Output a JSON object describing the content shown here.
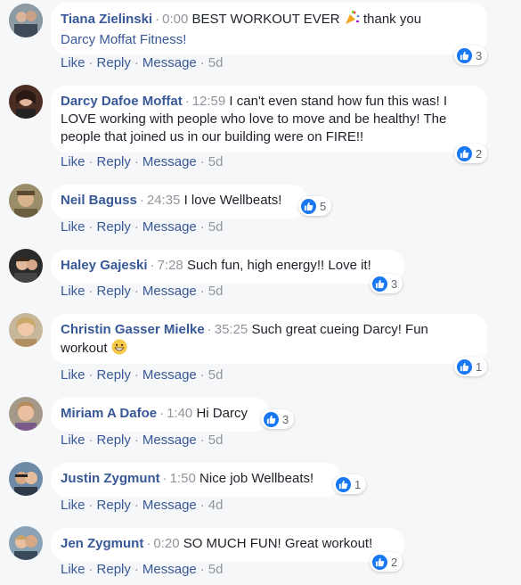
{
  "comments": [
    {
      "author": "Tiana Zielinski",
      "ts": "0:00",
      "text": "BEST WORKOUT EVER",
      "emoji": "party-popper",
      "text2": "thank you",
      "mention": "Darcy Moffat Fitness!",
      "likes": "3",
      "age": "5d"
    },
    {
      "author": "Darcy Dafoe Moffat",
      "ts": "12:59",
      "line1": "I can't even stand how fun this was! I",
      "line2": "LOVE working with people who love to move and be healthy! The",
      "line3": "people that joined us in our building were on FIRE!!",
      "likes": "2",
      "age": "5d"
    },
    {
      "author": "Neil Baguss",
      "ts": "24:35",
      "text": "I love Wellbeats!",
      "likes": "5",
      "age": "5d"
    },
    {
      "author": "Haley Gajeski",
      "ts": "7:28",
      "text": "Such fun, high energy!! Love it!",
      "likes": "3",
      "age": "5d"
    },
    {
      "author": "Christin Gasser Mielke",
      "ts": "35:25",
      "line1": "Such great cueing Darcy! Fun",
      "line2": "workout",
      "emoji": "grinning-face",
      "likes": "1",
      "age": "5d"
    },
    {
      "author": "Miriam A Dafoe",
      "ts": "1:40",
      "text": "Hi Darcy",
      "likes": "3",
      "age": "5d"
    },
    {
      "author": "Justin Zygmunt",
      "ts": "1:50",
      "text": "Nice job Wellbeats!",
      "likes": "1",
      "age": "4d"
    },
    {
      "author": "Jen Zygmunt",
      "ts": "0:20",
      "text": "SO MUCH FUN! Great workout!",
      "likes": "2",
      "age": "5d"
    }
  ],
  "actions": {
    "like": "Like",
    "reply": "Reply",
    "message": "Message"
  },
  "colors": {
    "link": "#385898",
    "meta": "#90949c",
    "like_blue": "#1877f2",
    "bubble": "#ffffff",
    "page_bg": "#f6f7f9"
  }
}
